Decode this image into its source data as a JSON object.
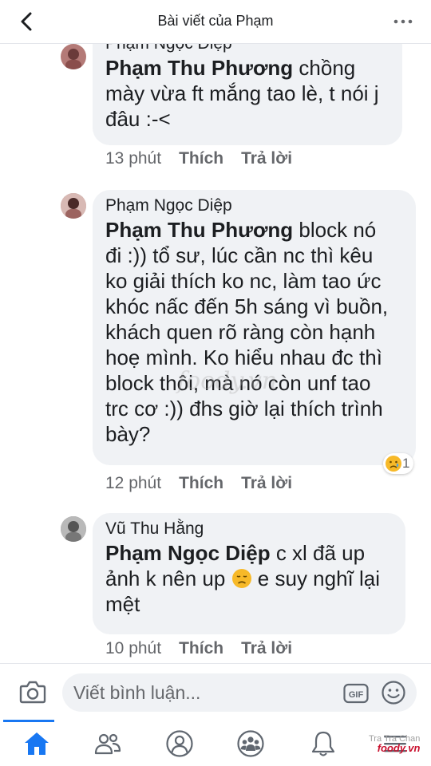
{
  "header": {
    "title": "Bài viết của Phạm"
  },
  "comments": [
    {
      "author": "Phạm Ngọc Diệp",
      "mention": "Phạm Thu Phương",
      "lines": [
        " chồng",
        "mày vừa ft mắng tao lè, t nói j",
        "đâu :-<"
      ],
      "time": "13 phút",
      "like": "Thích",
      "reply": "Trả lời"
    },
    {
      "author": "Phạm Ngọc Diệp",
      "mention": "Phạm Thu Phương",
      "lines": [
        " block nó",
        "đi :)) tổ sư, lúc cần nc thì kêu",
        "ko giải thích ko nc, làm tao ức",
        "khóc nấc đến 5h sáng vì buồn,",
        "khách quen rõ ràng còn hạnh",
        "hoẹ mình. Ko hiểu nhau đc thì",
        "block thôi, mà nó còn unf tao",
        "trc cơ :)) đhs giờ lại thích trình",
        "bày?"
      ],
      "time": "12 phút",
      "like": "Thích",
      "reply": "Trả lời",
      "reaction_count": "1",
      "watermark": "foody.vn"
    },
    {
      "author": "Vũ Thu Hằng",
      "mention": "Phạm Ngọc Diệp",
      "lines": [
        "  c xl đã up",
        "ảnh k nên up ",
        " e suy nghĩ lại",
        "mệt"
      ],
      "time": "10 phút",
      "like": "Thích",
      "reply": "Trả lời"
    }
  ],
  "composer": {
    "placeholder": "Viết bình luận...",
    "gif_label": "GIF"
  },
  "tabs": [
    {
      "name": "home-icon",
      "active": true
    },
    {
      "name": "friends-icon",
      "active": false
    },
    {
      "name": "profile-icon",
      "active": false
    },
    {
      "name": "groups-icon",
      "active": false
    },
    {
      "name": "bell-icon",
      "active": false
    },
    {
      "name": "menu-icon",
      "active": false
    }
  ],
  "watermark": {
    "line1": "Tra Tra Chan",
    "brand": "foody.vn"
  },
  "colors": {
    "accent": "#1877f2",
    "bubble": "#f0f2f5",
    "secondary_text": "#65676b"
  }
}
